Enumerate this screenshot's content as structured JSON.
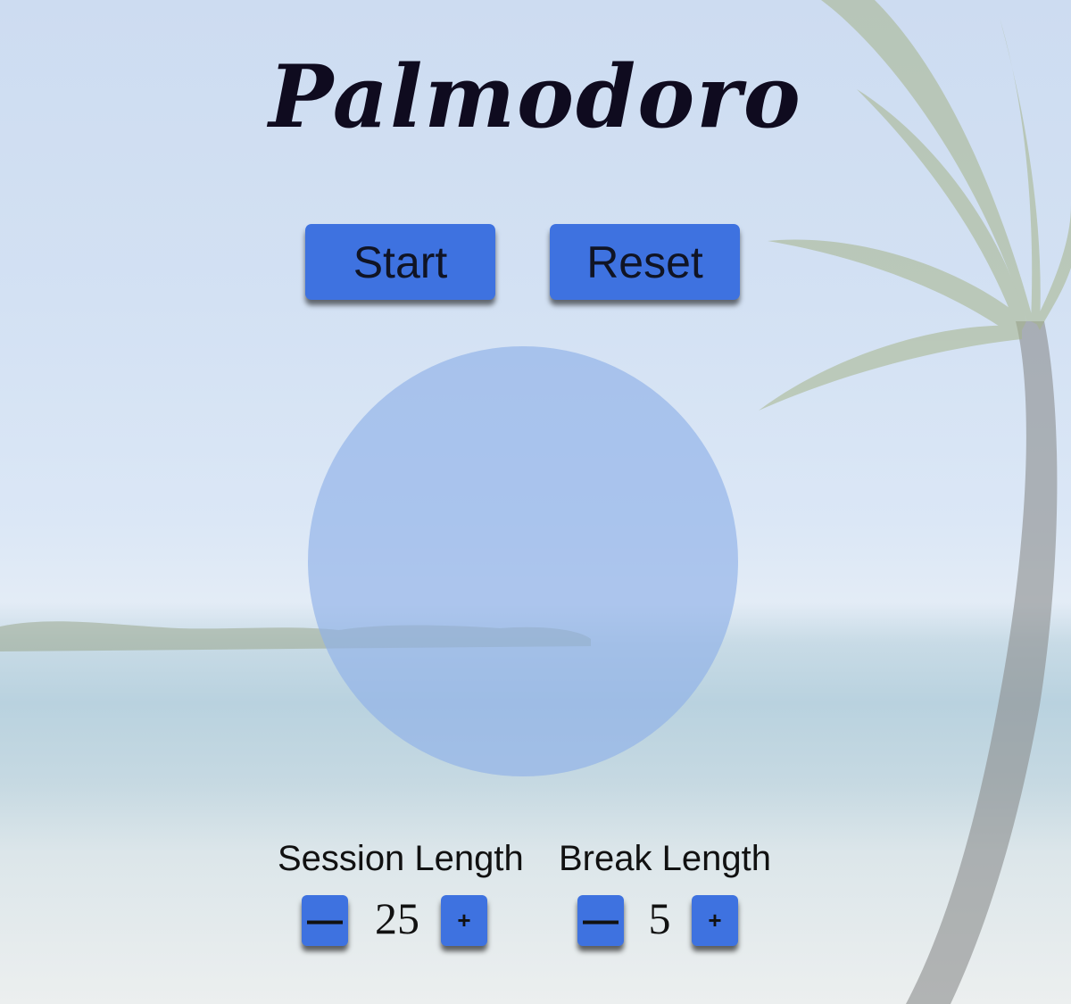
{
  "app": {
    "title": "Palmodoro"
  },
  "controls": {
    "start_label": "Start",
    "reset_label": "Reset"
  },
  "session": {
    "label": "Session Length",
    "value": "25",
    "decrement_label": "—",
    "increment_label": "+"
  },
  "break": {
    "label": "Break Length",
    "value": "5",
    "decrement_label": "—",
    "increment_label": "+"
  },
  "colors": {
    "button": "#3e72e0",
    "timer_circle": "#8fb0e8",
    "title": "#0f0b1f"
  }
}
